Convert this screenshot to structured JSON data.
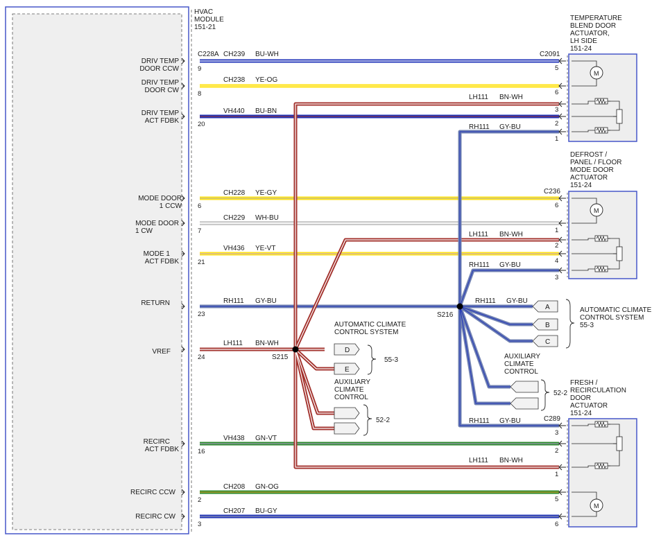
{
  "colors": {
    "BU": "#1f33b8",
    "YE": "#ffe31a",
    "BN": "#a3322d",
    "GY": "#6f80b2",
    "WH": "#f4f4f4",
    "GN": "#2b8a2b",
    "module_border": "#4657c9",
    "text": "#1a1a1a"
  },
  "hvac_module": {
    "title": [
      "HVAC",
      "MODULE",
      "151-21"
    ],
    "pins": [
      {
        "label": [
          "DRIV TEMP",
          "DOOR CCW"
        ],
        "pin": "9"
      },
      {
        "label": [
          "DRIV TEMP",
          "DOOR CW"
        ],
        "pin": "8"
      },
      {
        "label": [
          "DRIV TEMP",
          "ACT FDBK"
        ],
        "pin": "20"
      },
      {
        "label": [
          "MODE DOOR",
          "1 CCW"
        ],
        "pin": "6"
      },
      {
        "label": [
          "MODE DOOR",
          "1 CW"
        ],
        "pin": "7"
      },
      {
        "label": [
          "MODE 1",
          "ACT FDBK"
        ],
        "pin": "21"
      },
      {
        "label": [
          "RETURN"
        ],
        "pin": "23"
      },
      {
        "label": [
          "VREF"
        ],
        "pin": "24"
      },
      {
        "label": [
          "RECIRC",
          "ACT FDBK"
        ],
        "pin": "16"
      },
      {
        "label": [
          "RECIRC CCW"
        ],
        "pin": "2"
      },
      {
        "label": [
          "RECIRC CW"
        ],
        "pin": "3"
      }
    ],
    "connector": "C228A"
  },
  "actuators": [
    {
      "title": [
        "TEMPERATURE",
        "BLEND DOOR",
        "ACTUATOR,",
        "LH SIDE",
        "151-24"
      ],
      "connector": "C2091",
      "pins": [
        "5",
        "6",
        "3",
        "2",
        "1"
      ]
    },
    {
      "title": [
        "DEFROST /",
        "PANEL / FLOOR",
        "MODE DOOR",
        "ACTUATOR",
        "151-24"
      ],
      "connector": "C236",
      "pins": [
        "6",
        "1",
        "2",
        "4",
        "3"
      ]
    },
    {
      "title": [
        "FRESH /",
        "RECIRCULATION",
        "DOOR",
        "ACTUATOR",
        "151-24"
      ],
      "connector": "C289",
      "pins": [
        "3",
        "2",
        "1",
        "5",
        "6"
      ]
    }
  ],
  "wires": [
    {
      "circuit": "CH239",
      "color_code": "BU-WH"
    },
    {
      "circuit": "CH238",
      "color_code": "YE-OG"
    },
    {
      "circuit": "LH111",
      "color_code": "BN-WH"
    },
    {
      "circuit": "VH440",
      "color_code": "BU-BN"
    },
    {
      "circuit": "RH111",
      "color_code": "GY-BU"
    },
    {
      "circuit": "CH228",
      "color_code": "YE-GY"
    },
    {
      "circuit": "CH229",
      "color_code": "WH-BU"
    },
    {
      "circuit": "LH111",
      "color_code": "BN-WH"
    },
    {
      "circuit": "VH436",
      "color_code": "YE-VT"
    },
    {
      "circuit": "RH111",
      "color_code": "GY-BU"
    },
    {
      "circuit": "RH111",
      "color_code": "GY-BU"
    },
    {
      "circuit": "RH111",
      "color_code": "GY-BU"
    },
    {
      "circuit": "LH111",
      "color_code": "BN-WH"
    },
    {
      "circuit": "RH111",
      "color_code": "GY-BU"
    },
    {
      "circuit": "VH438",
      "color_code": "GN-VT"
    },
    {
      "circuit": "LH111",
      "color_code": "BN-WH"
    },
    {
      "circuit": "CH208",
      "color_code": "GN-OG"
    },
    {
      "circuit": "CH207",
      "color_code": "BU-GY"
    }
  ],
  "splices": [
    "S215",
    "S216"
  ],
  "s216_branch": {
    "circuit": "RH111",
    "color_code": "GY-BU"
  },
  "s216_connectors": [
    "A",
    "B",
    "C"
  ],
  "s215_connectors": [
    "D",
    "E"
  ],
  "refs": [
    {
      "label": [
        "AUTOMATIC CLIMATE",
        "CONTROL SYSTEM",
        "55-3"
      ]
    },
    {
      "label": [
        "AUXILIARY",
        "CLIMATE",
        "CONTROL"
      ],
      "page": "52-2"
    },
    {
      "label": [
        "AUTOMATIC CLIMATE",
        "CONTROL SYSTEM"
      ],
      "page": "55-3"
    },
    {
      "label": [
        "AUXILIARY",
        "CLIMATE",
        "CONTROL"
      ],
      "page": "52-2"
    }
  ]
}
